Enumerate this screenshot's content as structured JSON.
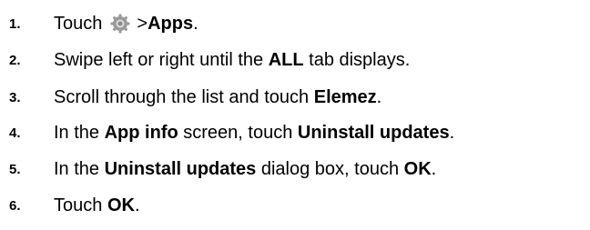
{
  "steps": [
    {
      "number": "1.",
      "parts": [
        "Touch",
        "> ",
        "Apps",
        "."
      ],
      "icon": "settings-gear-icon"
    },
    {
      "number": "2.",
      "parts": [
        "Swipe left or right until the ",
        "ALL",
        " tab displays."
      ]
    },
    {
      "number": "3.",
      "parts": [
        "Scroll through the list and touch ",
        "Elemez",
        "."
      ]
    },
    {
      "number": "4.",
      "parts": [
        "In the ",
        "App info",
        " screen, touch ",
        "Uninstall updates",
        "."
      ]
    },
    {
      "number": "5.",
      "parts": [
        "In the ",
        "Uninstall updates",
        " dialog box, touch ",
        "OK",
        "."
      ]
    },
    {
      "number": "6.",
      "parts": [
        "Touch ",
        "OK",
        "."
      ]
    }
  ]
}
